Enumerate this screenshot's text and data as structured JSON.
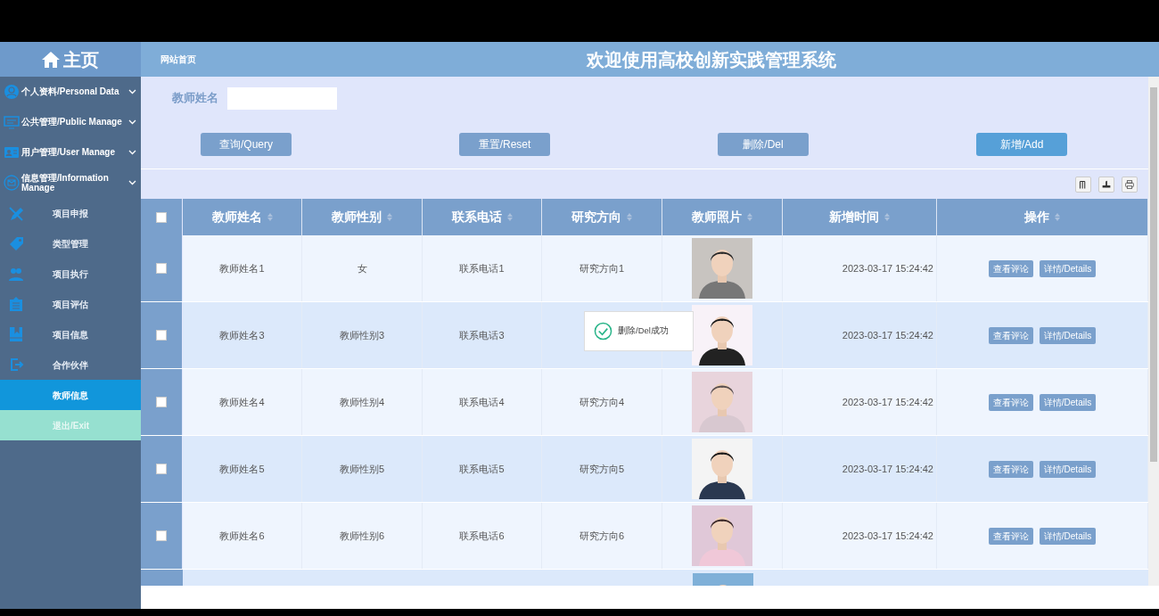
{
  "sidebar": {
    "home": "主页",
    "menus": [
      {
        "label": "个人资料/Personal Data"
      },
      {
        "label": "公共管理/Public Manage"
      },
      {
        "label": "用户管理/User Manage"
      },
      {
        "label": "信息管理/Information Manage"
      }
    ],
    "items": [
      {
        "label": "项目申报",
        "selected": false
      },
      {
        "label": "类型管理",
        "selected": false
      },
      {
        "label": "项目执行",
        "selected": false
      },
      {
        "label": "项目评估",
        "selected": false
      },
      {
        "label": "项目信息",
        "selected": false
      },
      {
        "label": "合作伙伴",
        "selected": false
      },
      {
        "label": "教师信息",
        "selected": true
      }
    ],
    "exit": "退出/Exit"
  },
  "header": {
    "breadcrumb": "网站首页",
    "title": "欢迎使用高校创新实践管理系统"
  },
  "search": {
    "label": "教师姓名"
  },
  "buttons": [
    {
      "label": "查询/Query",
      "hovered": false
    },
    {
      "label": "重置/Reset",
      "hovered": false
    },
    {
      "label": "删除/Del",
      "hovered": false
    },
    {
      "label": "新增/Add",
      "hovered": true
    }
  ],
  "table": {
    "select_all": {
      "checked": false
    },
    "columns": [
      "教师姓名",
      "教师性别",
      "联系电话",
      "研究方向",
      "教师照片",
      "新增时间",
      "操作"
    ],
    "rows": [
      {
        "checked": false,
        "name": "教师姓名1",
        "gender": "女",
        "phone": "联系电话1",
        "direction": "研究方向1",
        "time": "2023-03-17 15:24:42",
        "actions": [
          "查看评论",
          "详情/Details"
        ]
      },
      {
        "checked": false,
        "name": "教师姓名3",
        "gender": "教师性别3",
        "phone": "联系电话3",
        "time": "2023-03-17 15:24:42",
        "actions": [
          "查看评论",
          "详情/Details"
        ]
      },
      {
        "checked": false,
        "name": "教师姓名4",
        "gender": "教师性别4",
        "phone": "联系电话4",
        "direction": "研究方向4",
        "time": "2023-03-17 15:24:42",
        "actions": [
          "查看评论",
          "详情/Details"
        ]
      },
      {
        "checked": false,
        "name": "教师姓名5",
        "gender": "教师性别5",
        "phone": "联系电话5",
        "direction": "研究方向5",
        "time": "2023-03-17 15:24:42",
        "actions": [
          "查看评论",
          "详情/Details"
        ]
      },
      {
        "checked": false,
        "name": "教师姓名6",
        "gender": "教师性别6",
        "phone": "联系电话6",
        "direction": "研究方向6",
        "time": "2023-03-17 15:24:42",
        "actions": [
          "查看评论",
          "详情/Details"
        ]
      }
    ]
  },
  "toast": {
    "message": "删除/Del成功"
  }
}
